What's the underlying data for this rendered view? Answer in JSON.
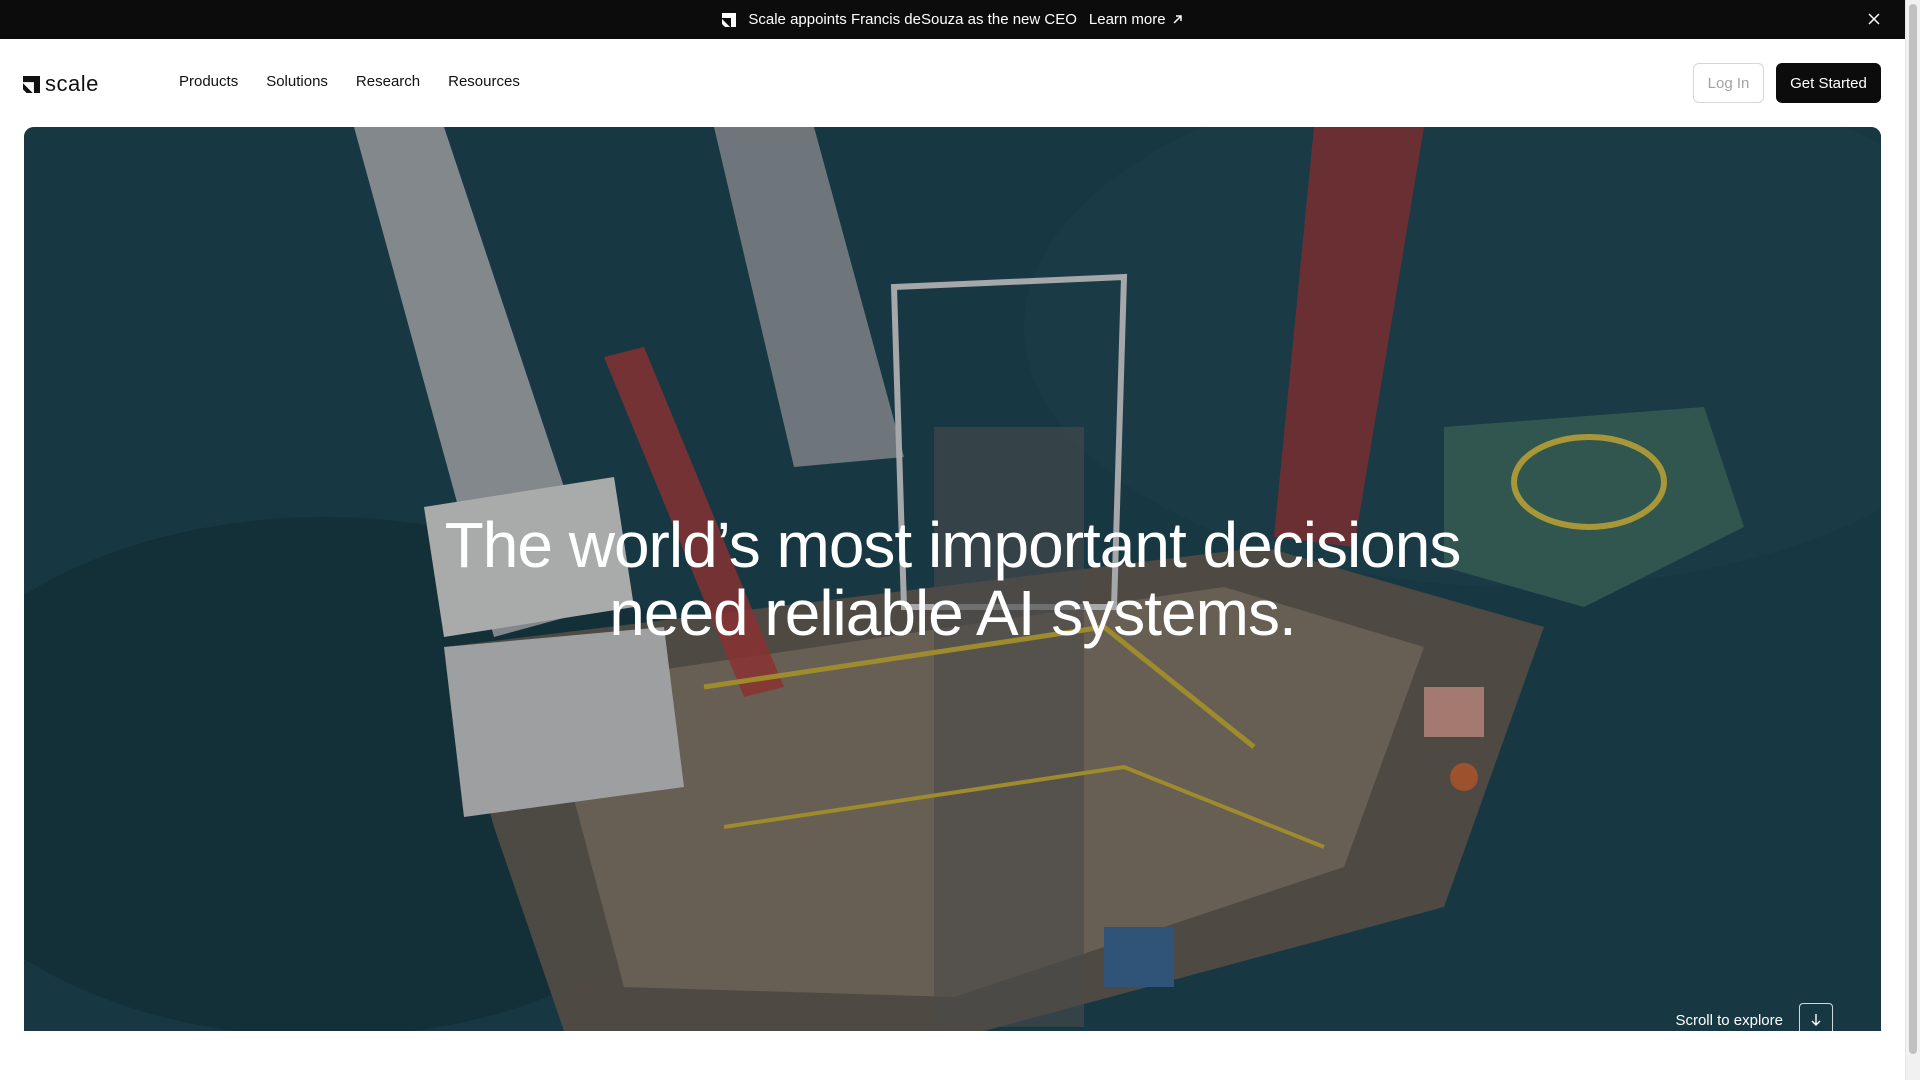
{
  "announcement": {
    "text": "Scale appoints Francis deSouza as the new CEO",
    "link_label": "Learn more"
  },
  "header": {
    "logo_text": "scale",
    "nav": [
      {
        "label": "Products"
      },
      {
        "label": "Solutions"
      },
      {
        "label": "Research"
      },
      {
        "label": "Resources"
      }
    ],
    "login_label": "Log In",
    "cta_label": "Get Started"
  },
  "hero": {
    "headline_line1": "The world’s most important decisions",
    "headline_line2": "need reliable AI systems.",
    "scroll_label": "Scroll to explore"
  },
  "colors": {
    "announce_bg": "#0c0c0c",
    "cta_bg": "#0c0c0c",
    "ocean": "#1f4a58"
  }
}
